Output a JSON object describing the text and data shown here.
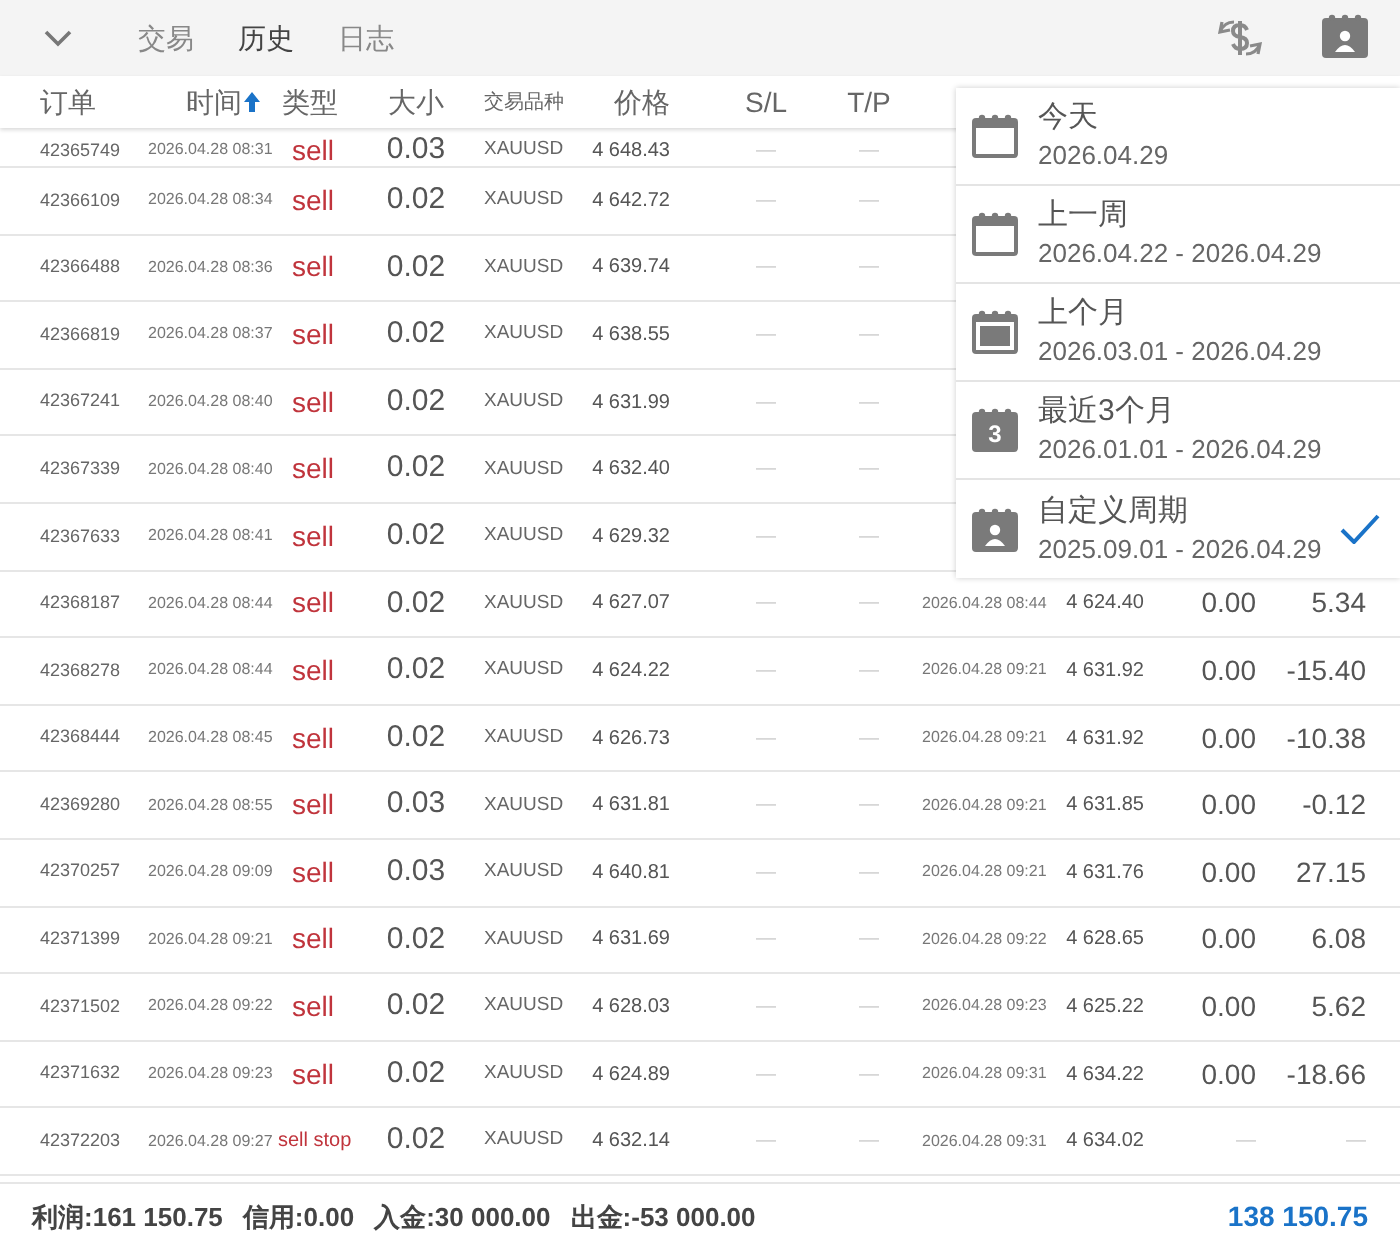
{
  "tabs": [
    {
      "label": "交易",
      "selected": false
    },
    {
      "label": "历史",
      "selected": true
    },
    {
      "label": "日志",
      "selected": false
    }
  ],
  "columns": [
    {
      "label": "订单",
      "sorted": false
    },
    {
      "label": "时间",
      "sorted": true
    },
    {
      "label": "类型",
      "sorted": false
    },
    {
      "label": "大小",
      "sorted": false
    },
    {
      "label": "交易品种",
      "sorted": false
    },
    {
      "label": "价格",
      "sorted": false
    },
    {
      "label": "S/L",
      "sorted": false
    },
    {
      "label": "T/P",
      "sorted": false
    }
  ],
  "rows": [
    {
      "kind": "deal",
      "order": "42365749",
      "time": "2026.04.28 08:31",
      "type": "sell",
      "size": "0.03",
      "symbol": "XAUUSD",
      "price": "4 648.43",
      "sl": "—",
      "tp": "—"
    },
    {
      "kind": "deal",
      "order": "42366109",
      "time": "2026.04.28 08:34",
      "type": "sell",
      "size": "0.02",
      "symbol": "XAUUSD",
      "price": "4 642.72",
      "sl": "—",
      "tp": "—"
    },
    {
      "kind": "deal",
      "order": "42366488",
      "time": "2026.04.28 08:36",
      "type": "sell",
      "size": "0.02",
      "symbol": "XAUUSD",
      "price": "4 639.74",
      "sl": "—",
      "tp": "—"
    },
    {
      "kind": "deal",
      "order": "42366819",
      "time": "2026.04.28 08:37",
      "type": "sell",
      "size": "0.02",
      "symbol": "XAUUSD",
      "price": "4 638.55",
      "sl": "—",
      "tp": "—"
    },
    {
      "kind": "deal",
      "order": "42367241",
      "time": "2026.04.28 08:40",
      "type": "sell",
      "size": "0.02",
      "symbol": "XAUUSD",
      "price": "4 631.99",
      "sl": "—",
      "tp": "—"
    },
    {
      "kind": "deal",
      "order": "42367339",
      "time": "2026.04.28 08:40",
      "type": "sell",
      "size": "0.02",
      "symbol": "XAUUSD",
      "price": "4 632.40",
      "sl": "—",
      "tp": "—"
    },
    {
      "kind": "deal",
      "order": "42367633",
      "time": "2026.04.28 08:41",
      "type": "sell",
      "size": "0.02",
      "symbol": "XAUUSD",
      "price": "4 629.32",
      "sl": "—",
      "tp": "—"
    },
    {
      "kind": "deal",
      "order": "42368187",
      "time": "2026.04.28 08:44",
      "type": "sell",
      "size": "0.02",
      "symbol": "XAUUSD",
      "price": "4 627.07",
      "sl": "—",
      "tp": "—",
      "close_time": "2026.04.28 08:44",
      "close_price": "4 624.40",
      "swap": "0.00",
      "profit": "5.34"
    },
    {
      "kind": "deal",
      "order": "42368278",
      "time": "2026.04.28 08:44",
      "type": "sell",
      "size": "0.02",
      "symbol": "XAUUSD",
      "price": "4 624.22",
      "sl": "—",
      "tp": "—",
      "close_time": "2026.04.28 09:21",
      "close_price": "4 631.92",
      "swap": "0.00",
      "profit": "-15.40"
    },
    {
      "kind": "deal",
      "order": "42368444",
      "time": "2026.04.28 08:45",
      "type": "sell",
      "size": "0.02",
      "symbol": "XAUUSD",
      "price": "4 626.73",
      "sl": "—",
      "tp": "—",
      "close_time": "2026.04.28 09:21",
      "close_price": "4 631.92",
      "swap": "0.00",
      "profit": "-10.38"
    },
    {
      "kind": "deal",
      "order": "42369280",
      "time": "2026.04.28 08:55",
      "type": "sell",
      "size": "0.03",
      "symbol": "XAUUSD",
      "price": "4 631.81",
      "sl": "—",
      "tp": "—",
      "close_time": "2026.04.28 09:21",
      "close_price": "4 631.85",
      "swap": "0.00",
      "profit": "-0.12"
    },
    {
      "kind": "deal",
      "order": "42370257",
      "time": "2026.04.28 09:09",
      "type": "sell",
      "size": "0.03",
      "symbol": "XAUUSD",
      "price": "4 640.81",
      "sl": "—",
      "tp": "—",
      "close_time": "2026.04.28 09:21",
      "close_price": "4 631.76",
      "swap": "0.00",
      "profit": "27.15"
    },
    {
      "kind": "deal",
      "order": "42371399",
      "time": "2026.04.28 09:21",
      "type": "sell",
      "size": "0.02",
      "symbol": "XAUUSD",
      "price": "4 631.69",
      "sl": "—",
      "tp": "—",
      "close_time": "2026.04.28 09:22",
      "close_price": "4 628.65",
      "swap": "0.00",
      "profit": "6.08"
    },
    {
      "kind": "deal",
      "order": "42371502",
      "time": "2026.04.28 09:22",
      "type": "sell",
      "size": "0.02",
      "symbol": "XAUUSD",
      "price": "4 628.03",
      "sl": "—",
      "tp": "—",
      "close_time": "2026.04.28 09:23",
      "close_price": "4 625.22",
      "swap": "0.00",
      "profit": "5.62"
    },
    {
      "kind": "deal",
      "order": "42371632",
      "time": "2026.04.28 09:23",
      "type": "sell",
      "size": "0.02",
      "symbol": "XAUUSD",
      "price": "4 624.89",
      "sl": "—",
      "tp": "—",
      "close_time": "2026.04.28 09:31",
      "close_price": "4 634.22",
      "swap": "0.00",
      "profit": "-18.66"
    },
    {
      "kind": "order",
      "order": "42372203",
      "time": "2026.04.28 09:27",
      "type": "sell stop",
      "size": "0.02",
      "symbol": "XAUUSD",
      "price": "4 632.14",
      "sl": "—",
      "tp": "—",
      "close_time": "2026.04.28 09:31",
      "close_price": "4 634.02",
      "swap": "—",
      "profit": "—"
    }
  ],
  "footer": {
    "summary": [
      {
        "label": "利润:",
        "value": "161 150.75"
      },
      {
        "label": "信用:",
        "value": "0.00"
      },
      {
        "label": "入金:",
        "value": "30 000.00"
      },
      {
        "label": "出金:",
        "value": "-53 000.00"
      }
    ],
    "total": "138 150.75"
  },
  "period_menu": [
    {
      "kind": "today",
      "title": "今天",
      "range": "2026.04.29",
      "selected": false
    },
    {
      "kind": "week",
      "title": "上一周",
      "range": "2026.04.22 - 2026.04.29",
      "selected": false
    },
    {
      "kind": "month",
      "title": "上个月",
      "range": "2026.03.01 - 2026.04.29",
      "selected": false
    },
    {
      "kind": "months3",
      "icon_text": "3",
      "title": "最近3个月",
      "range": "2026.01.01 - 2026.04.29",
      "selected": false
    },
    {
      "kind": "custom",
      "title": "自定义周期",
      "range": "2025.09.01 - 2026.04.29",
      "selected": true
    }
  ]
}
